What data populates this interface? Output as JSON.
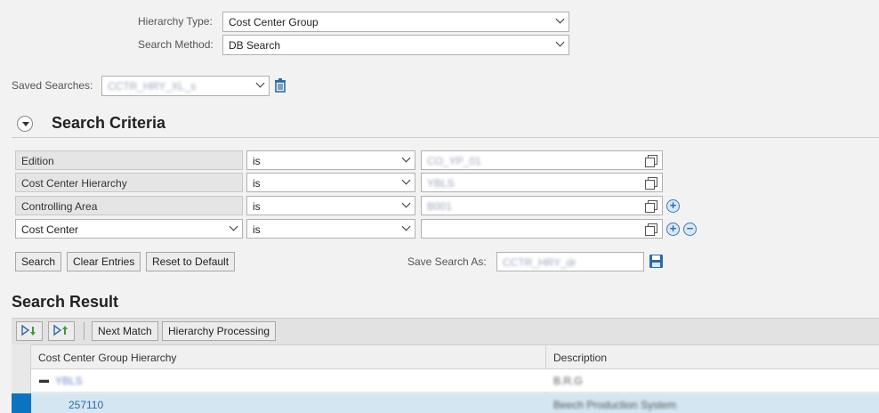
{
  "top": {
    "hierarchy_type_label": "Hierarchy Type:",
    "hierarchy_type_value": "Cost Center Group",
    "search_method_label": "Search Method:",
    "search_method_value": "DB Search"
  },
  "saved": {
    "label": "Saved Searches:",
    "value": "CCTR_HRY_XL_s"
  },
  "criteria": {
    "title": "Search Criteria",
    "rows": [
      {
        "field": "Edition",
        "op": "is",
        "value": "CO_YP_01"
      },
      {
        "field": "Cost Center Hierarchy",
        "op": "is",
        "value": "YBLS"
      },
      {
        "field": "Controlling Area",
        "op": "is",
        "value": "B001"
      },
      {
        "field": "Cost Center",
        "op": "is",
        "value": ""
      }
    ],
    "search_btn": "Search",
    "clear_btn": "Clear Entries",
    "reset_btn": "Reset to Default",
    "save_as_label": "Save Search As:",
    "save_as_value": "CCTR_HRY_dr"
  },
  "result": {
    "title": "Search Result",
    "next_match": "Next Match",
    "hierarchy_processing": "Hierarchy Processing",
    "col1": "Cost Center Group Hierarchy",
    "col2": "Description",
    "rows": [
      {
        "group": "YBLS",
        "desc": "B.R.G"
      },
      {
        "group": "257110",
        "desc": "Beech Production System"
      }
    ]
  }
}
